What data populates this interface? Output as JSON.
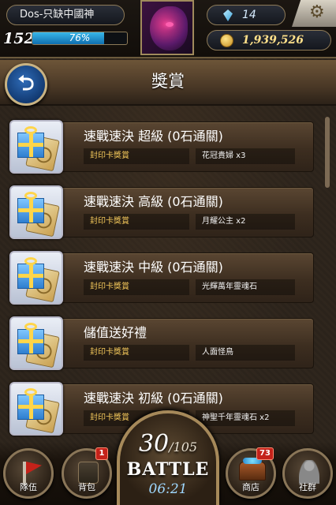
{
  "header": {
    "player_name": "Dos-只缺中國神",
    "level": "152",
    "exp_percent": "76%",
    "exp_fraction": 0.76,
    "gems": "14",
    "coins": "1,939,526"
  },
  "page": {
    "title": "獎賞",
    "back_icon": "back-arrow-icon"
  },
  "rewards": [
    {
      "title": "速戰速決 超級 (0石通關)",
      "type": "封印卡獎賞",
      "detail": "花冠貴婦 x3"
    },
    {
      "title": "速戰速決 高級 (0石通關)",
      "type": "封印卡獎賞",
      "detail": "月耀公主 x2"
    },
    {
      "title": "速戰速決 中級 (0石通關)",
      "type": "封印卡獎賞",
      "detail": "光輝萬年靈魂石"
    },
    {
      "title": "儲值送好禮",
      "type": "封印卡獎賞",
      "detail": "人面怪鳥"
    },
    {
      "title": "速戰速決 初級 (0石通關)",
      "type": "封印卡獎賞",
      "detail": "神聖千年靈魂石 x2"
    }
  ],
  "battle": {
    "stamina_current": "30",
    "stamina_max": "/105",
    "label": "BATTLE",
    "timer": "06:21"
  },
  "nav": {
    "team_label": "隊伍",
    "bag_label": "背包",
    "bag_badge": "1",
    "shop_label": "商店",
    "shop_badge": "73",
    "social_label": "社群"
  },
  "colors": {
    "accent_gold": "#f1c65a",
    "exp_blue": "#39b7e8",
    "badge_red": "#c4221a"
  }
}
